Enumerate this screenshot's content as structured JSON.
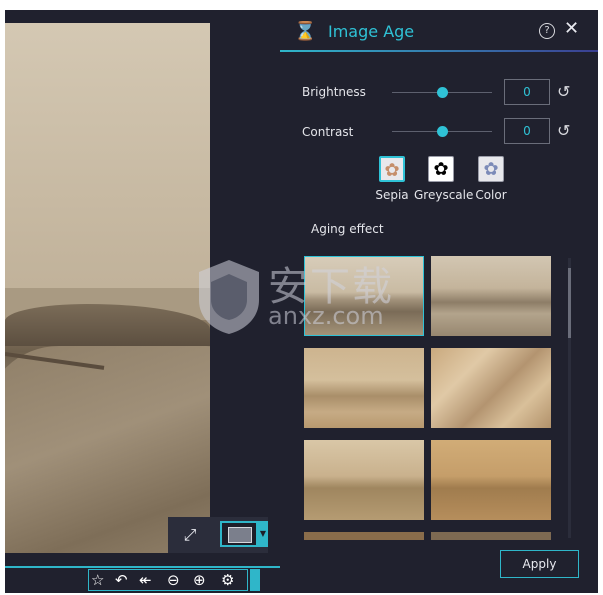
{
  "panel": {
    "title": "Image Age",
    "help_glyph": "?",
    "close_glyph": "✕",
    "title_icon": "hourglass-icon"
  },
  "brightness": {
    "label": "Brightness",
    "value": "0",
    "slider_fraction": 0.5
  },
  "contrast": {
    "label": "Contrast",
    "value": "0",
    "slider_fraction": 0.5
  },
  "modes": [
    {
      "label": "Sepia",
      "icon": "gear-icon",
      "color": "#c58e6a",
      "selected": true
    },
    {
      "label": "Greyscale",
      "icon": "gear-icon",
      "color": "#000000"
    },
    {
      "label": "Color",
      "icon": "gear-icon",
      "color": "#7c8bb8"
    }
  ],
  "aging": {
    "label": "Aging effect",
    "thumbnails": [
      {
        "style": "clean",
        "selected": true
      },
      {
        "style": "worn"
      },
      {
        "style": "stained"
      },
      {
        "style": "creased"
      },
      {
        "style": "faded"
      },
      {
        "style": "old-paper"
      }
    ]
  },
  "apply_label": "Apply",
  "toolbar_icons": [
    "star-icon",
    "undo-icon",
    "undo-all-icon",
    "zoom-out-icon",
    "zoom-in-icon",
    "settings-icon"
  ],
  "colors": {
    "accent": "#2fc2d6",
    "panel_bg": "#20212e"
  },
  "watermark": {
    "cn": "安下载",
    "en": "anxz.com"
  }
}
